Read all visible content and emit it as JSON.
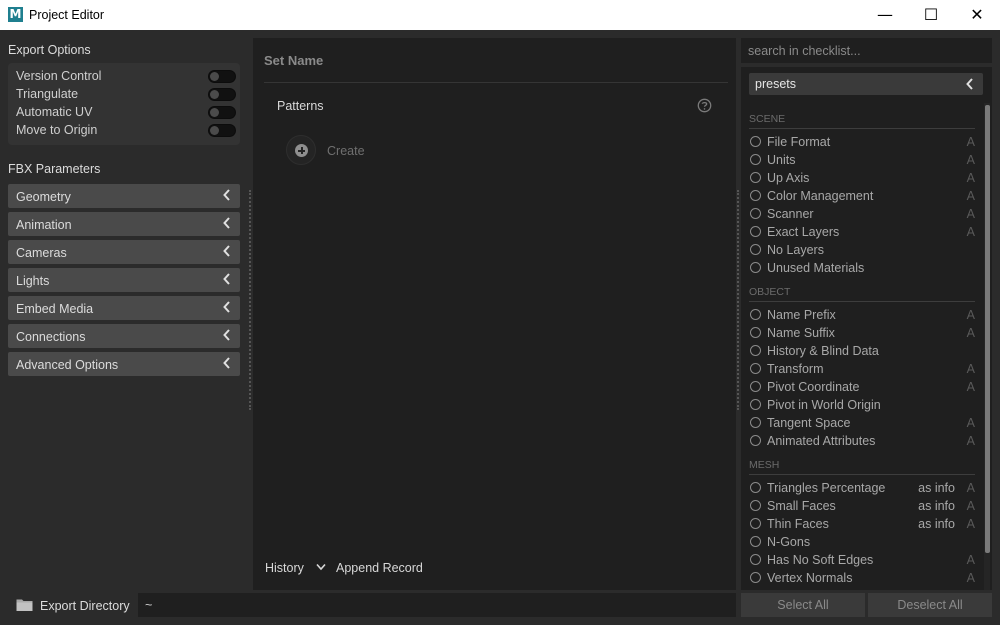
{
  "window": {
    "logo_letter": "M",
    "title": "Project Editor",
    "minimize_glyph": "—",
    "maximize_glyph": "☐",
    "close_glyph": "✕"
  },
  "export_options": {
    "title": "Export Options",
    "options": [
      {
        "label": "Version Control",
        "enabled": false
      },
      {
        "label": "Triangulate",
        "enabled": false
      },
      {
        "label": "Automatic UV",
        "enabled": false
      },
      {
        "label": "Move to Origin",
        "enabled": false
      }
    ]
  },
  "fbx": {
    "title": "FBX Parameters",
    "items": [
      "Geometry",
      "Animation",
      "Cameras",
      "Lights",
      "Embed Media",
      "Connections",
      "Advanced Options"
    ]
  },
  "center": {
    "set_name": "Set Name",
    "patterns_label": "Patterns",
    "create_label": "Create",
    "history_label": "History",
    "append_label": "Append Record"
  },
  "checklist": {
    "search_placeholder": "search in checklist...",
    "preset_label": "presets",
    "categories": [
      {
        "name": "SCENE",
        "items": [
          {
            "label": "File Format",
            "info": "",
            "flag": "A"
          },
          {
            "label": "Units",
            "info": "",
            "flag": "A"
          },
          {
            "label": "Up Axis",
            "info": "",
            "flag": "A"
          },
          {
            "label": "Color Management",
            "info": "",
            "flag": "A"
          },
          {
            "label": "Scanner",
            "info": "",
            "flag": "A"
          },
          {
            "label": "Exact Layers",
            "info": "",
            "flag": "A"
          },
          {
            "label": "No Layers",
            "info": "",
            "flag": ""
          },
          {
            "label": "Unused Materials",
            "info": "",
            "flag": ""
          }
        ]
      },
      {
        "name": "OBJECT",
        "items": [
          {
            "label": "Name Prefix",
            "info": "",
            "flag": "A"
          },
          {
            "label": "Name Suffix",
            "info": "",
            "flag": "A"
          },
          {
            "label": "History & Blind Data",
            "info": "",
            "flag": ""
          },
          {
            "label": "Transform",
            "info": "",
            "flag": "A"
          },
          {
            "label": "Pivot Coordinate",
            "info": "",
            "flag": "A"
          },
          {
            "label": "Pivot in World Origin",
            "info": "",
            "flag": ""
          },
          {
            "label": "Tangent Space",
            "info": "",
            "flag": "A"
          },
          {
            "label": "Animated Attributes",
            "info": "",
            "flag": "A"
          }
        ]
      },
      {
        "name": "MESH",
        "items": [
          {
            "label": "Triangles Percentage",
            "info": "as info",
            "flag": "A"
          },
          {
            "label": "Small Faces",
            "info": "as info",
            "flag": "A"
          },
          {
            "label": "Thin Faces",
            "info": "as info",
            "flag": "A"
          },
          {
            "label": "N-Gons",
            "info": "",
            "flag": ""
          },
          {
            "label": "Has No Soft Edges",
            "info": "",
            "flag": "A"
          },
          {
            "label": "Vertex Normals",
            "info": "",
            "flag": "A"
          }
        ]
      }
    ]
  },
  "bottom": {
    "export_dir_label": "Export Directory",
    "export_dir_value": "~",
    "select_all": "Select All",
    "deselect_all": "Deselect All"
  }
}
